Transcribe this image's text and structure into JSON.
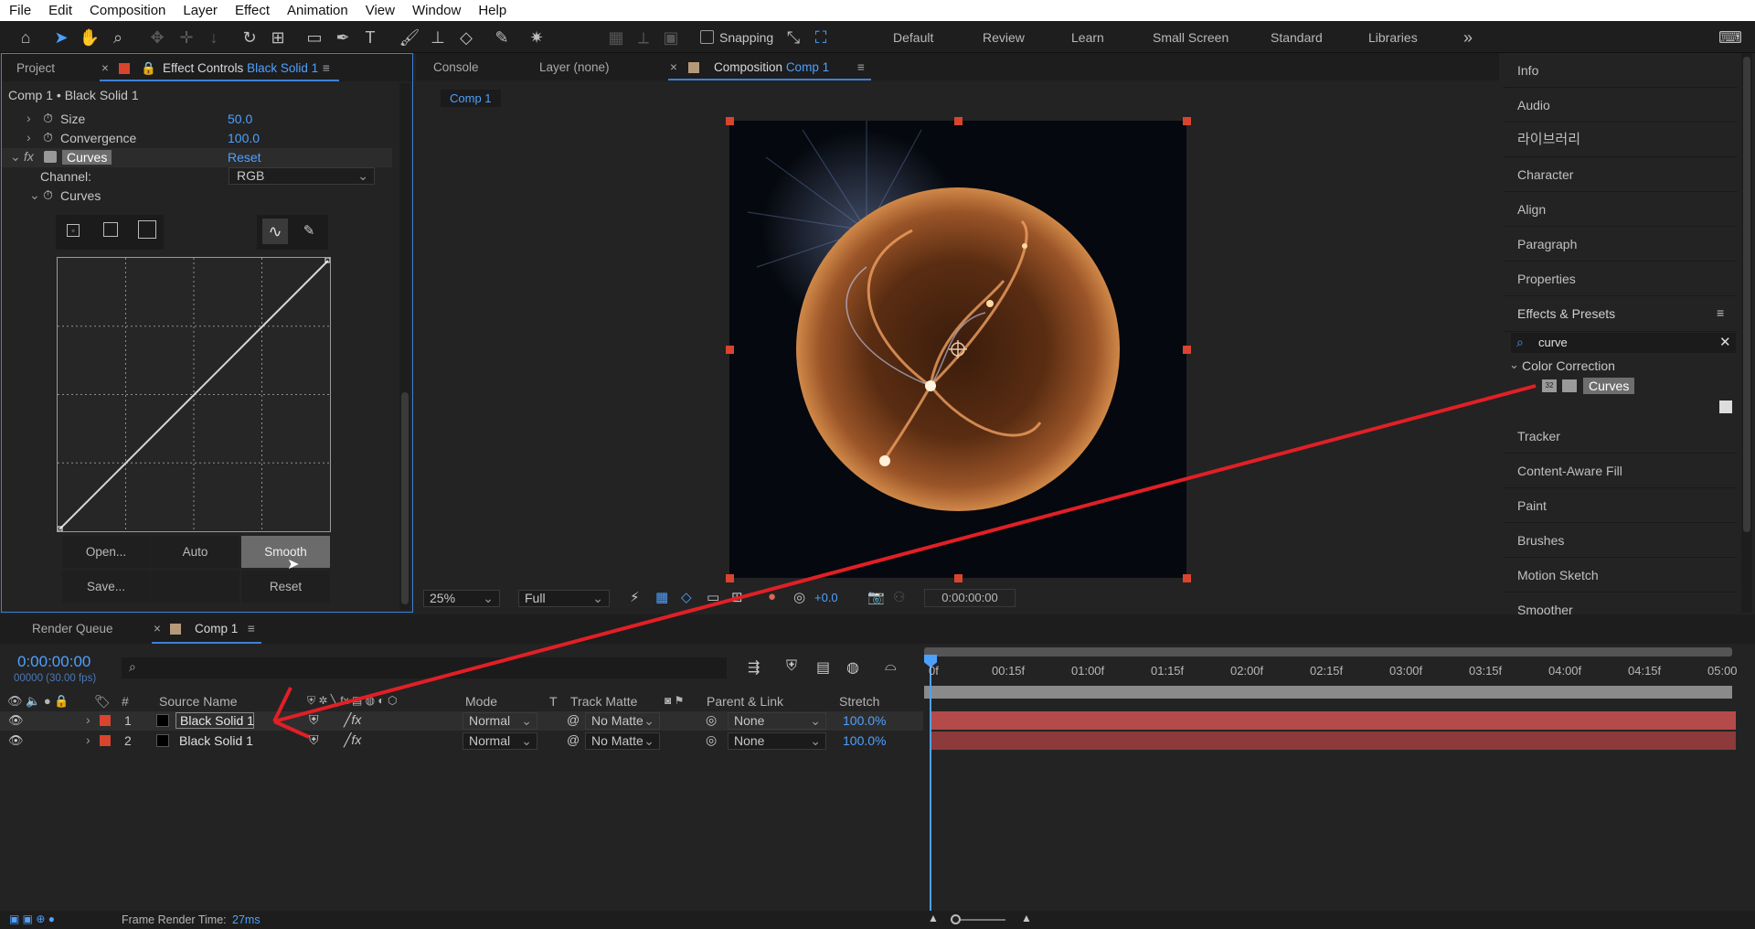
{
  "menu": [
    "File",
    "Edit",
    "Composition",
    "Layer",
    "Effect",
    "Animation",
    "View",
    "Window",
    "Help"
  ],
  "toolbar": {
    "snapping": "Snapping",
    "workspaces": [
      "Default",
      "Review",
      "Learn",
      "Small Screen",
      "Standard",
      "Libraries"
    ]
  },
  "left_panel": {
    "tab_project": "Project",
    "tab_effect_controls": "Effect Controls",
    "tab_effect_controls_layer": "Black Solid 1",
    "breadcrumb": "Comp 1 • Black Solid 1",
    "size_label": "Size",
    "size_value": "50.0",
    "convergence_label": "Convergence",
    "convergence_value": "100.0",
    "curves_effect": "Curves",
    "reset": "Reset",
    "channel_label": "Channel:",
    "channel_value": "RGB",
    "curves_prop": "Curves",
    "buttons": {
      "open": "Open...",
      "auto": "Auto",
      "smooth": "Smooth",
      "save": "Save...",
      "reset": "Reset"
    }
  },
  "comp_panel": {
    "tab_console": "Console",
    "tab_layer": "Layer (none)",
    "tab_composition": "Composition",
    "tab_composition_name": "Comp 1",
    "breadcrumb": "Comp 1",
    "zoom": "25%",
    "resolution": "Full",
    "exposure": "+0.0",
    "timecode": "0:00:00:00"
  },
  "right_panel": {
    "items_top": [
      "Info",
      "Audio",
      "라이브러리",
      "Character",
      "Align",
      "Paragraph",
      "Properties"
    ],
    "effects_presets": "Effects & Presets",
    "search_value": "curve",
    "category": "Color Correction",
    "result": "Curves",
    "items_bottom": [
      "Tracker",
      "Content-Aware Fill",
      "Paint",
      "Brushes",
      "Motion Sketch",
      "Smoother"
    ]
  },
  "timeline": {
    "tab_render_queue": "Render Queue",
    "tab_comp": "Comp 1",
    "timecode": "0:00:00:00",
    "frames": "00000 (30.00 fps)",
    "columns": {
      "num": "#",
      "source_name": "Source Name",
      "mode": "Mode",
      "t": "T",
      "track_matte": "Track Matte",
      "parent": "Parent & Link",
      "stretch": "Stretch"
    },
    "ruler": [
      "0f",
      "00:15f",
      "01:00f",
      "01:15f",
      "02:00f",
      "02:15f",
      "03:00f",
      "03:15f",
      "04:00f",
      "04:15f",
      "05:00"
    ],
    "layers": [
      {
        "num": "1",
        "name": "Black Solid 1",
        "mode": "Normal",
        "matte": "No Matte",
        "parent": "None",
        "stretch": "100.0%"
      },
      {
        "num": "2",
        "name": "Black Solid 1",
        "mode": "Normal",
        "matte": "No Matte",
        "parent": "None",
        "stretch": "100.0%"
      }
    ],
    "frame_render_label": "Frame Render Time:",
    "frame_render_value": "27ms"
  },
  "colors": {
    "accent": "#4ea0ff",
    "layer_label": "#d9442e",
    "bar": "#b54a4a",
    "arrow": "#e21f26"
  }
}
